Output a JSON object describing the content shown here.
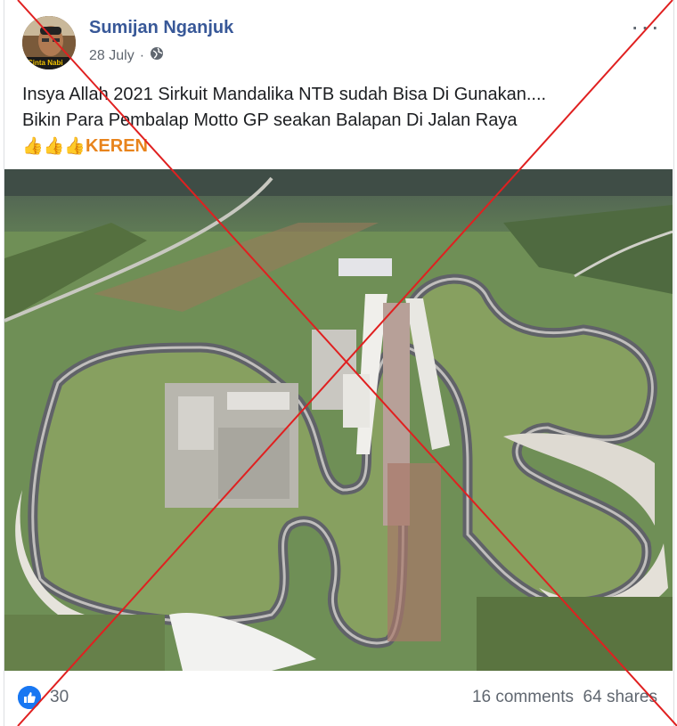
{
  "post": {
    "author": "Sumijan Nganjuk",
    "date": "28 July",
    "date_separator": "·",
    "avatar_caption": "Cinta Nabi",
    "text_line1": "Insya Allah 2021 Sirkuit Mandalika NTB sudah Bisa Di Gunakan....",
    "text_line2": "Bikin Para Pembalap Motto GP seakan Balapan Di Jalan Raya",
    "emojis": "👍👍👍",
    "highlight": "KEREN",
    "more_label": "···"
  },
  "footer": {
    "reactions_count": "30",
    "comments": "16 comments",
    "shares": "64 shares"
  },
  "icons": {
    "globe": "globe-icon",
    "like": "like-reaction-icon",
    "more": "more-options-icon"
  },
  "colors": {
    "author": "#385898",
    "highlight": "#e8841d",
    "cross": "#e02020",
    "like_badge": "#1877f2"
  }
}
